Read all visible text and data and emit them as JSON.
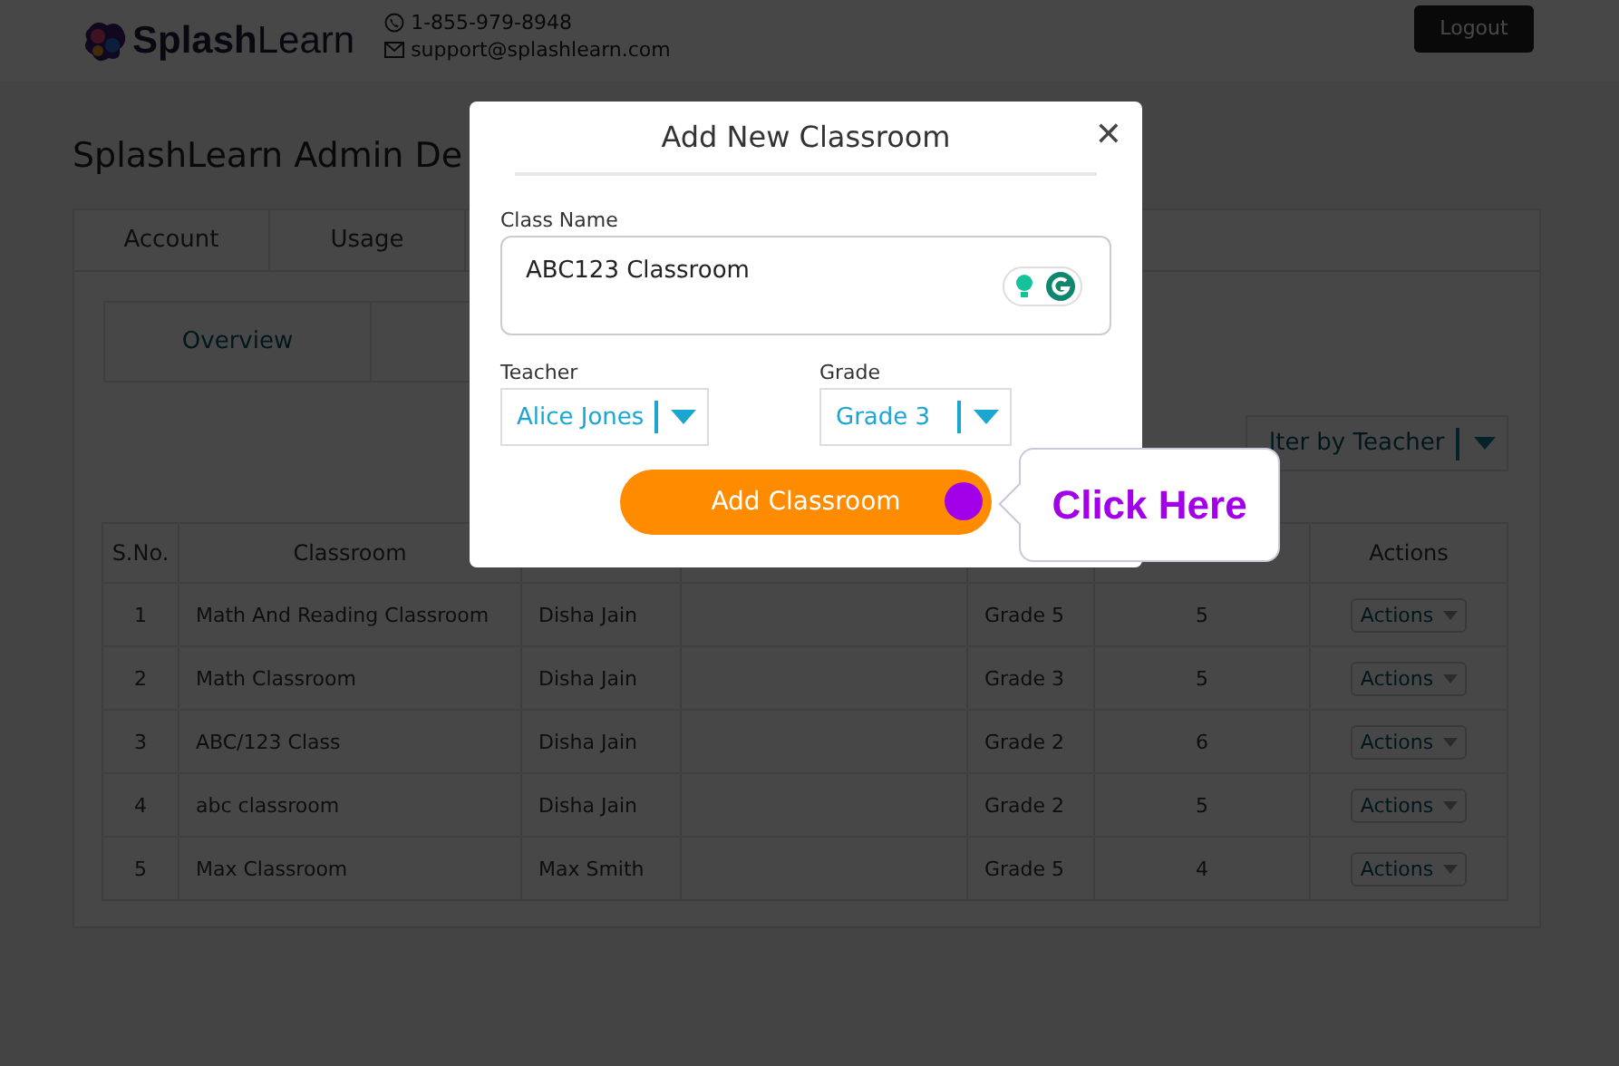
{
  "header": {
    "logo": "**Splash**Learn",
    "phone": "1-855-979-8948",
    "email": "support@splashlearn.com",
    "logout": "Logout"
  },
  "page_title": "SplashLearn Admin De",
  "tabs": [
    {
      "label": "Account",
      "selected": false
    },
    {
      "label": "Usage",
      "selected": false
    }
  ],
  "subtabs": [
    {
      "label": "Overview",
      "selected": true
    }
  ],
  "filter": {
    "value": "lter by Teacher"
  },
  "table": {
    "columns": [
      {
        "label": "S.No."
      },
      {
        "label": "Classroom"
      },
      {},
      {},
      {},
      {},
      {
        "label": "Actions"
      }
    ],
    "rows": [
      {
        "cells": [
          "1",
          "Math And Reading Classroom",
          "Disha Jain",
          "",
          "Grade 5",
          "5"
        ],
        "action": "Actions"
      },
      {
        "cells": [
          "2",
          "Math Classroom",
          "Disha Jain",
          "",
          "Grade 3",
          "5"
        ],
        "action": "Actions"
      },
      {
        "cells": [
          "3",
          "ABC/123 Class",
          "Disha Jain",
          "",
          "Grade 2",
          "6"
        ],
        "action": "Actions"
      },
      {
        "cells": [
          "4",
          "abc classroom",
          "Disha Jain",
          "",
          "Grade 2",
          "5"
        ],
        "action": "Actions"
      },
      {
        "cells": [
          "5",
          "Max Classroom",
          "Max Smith",
          "",
          "Grade 5",
          "4"
        ],
        "action": "Actions"
      }
    ]
  },
  "modal": {
    "title": "Add New Classroom",
    "close": "✕",
    "class_name": {
      "label": "Class Name",
      "value": "ABC123 Classroom"
    },
    "teacher": {
      "label": "Teacher",
      "value": "Alice Jones"
    },
    "grade": {
      "label": "Grade",
      "value": "Grade 3"
    },
    "submit": "Add Classroom"
  },
  "tooltip": {
    "text": "Click Here"
  }
}
